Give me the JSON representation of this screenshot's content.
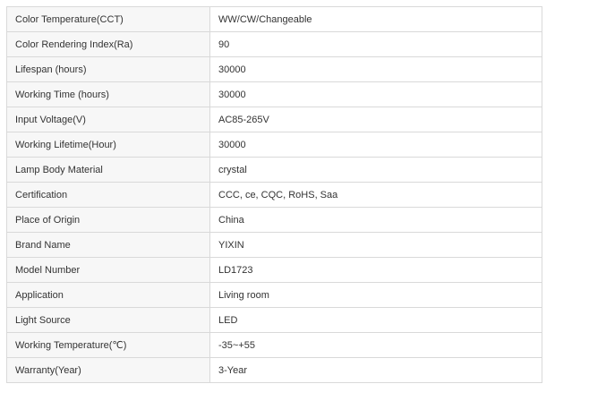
{
  "spec_table": {
    "rows": [
      {
        "label": "Color Temperature(CCT)",
        "value": "WW/CW/Changeable"
      },
      {
        "label": "Color Rendering Index(Ra)",
        "value": "90"
      },
      {
        "label": "Lifespan (hours)",
        "value": "30000"
      },
      {
        "label": "Working Time (hours)",
        "value": "30000"
      },
      {
        "label": "Input Voltage(V)",
        "value": "AC85-265V"
      },
      {
        "label": "Working Lifetime(Hour)",
        "value": "30000"
      },
      {
        "label": "Lamp Body Material",
        "value": "crystal"
      },
      {
        "label": "Certification",
        "value": "CCC, ce, CQC, RoHS, Saa"
      },
      {
        "label": "Place of Origin",
        "value": "China"
      },
      {
        "label": "Brand Name",
        "value": "YIXIN"
      },
      {
        "label": "Model Number",
        "value": "LD1723"
      },
      {
        "label": "Application",
        "value": "Living room"
      },
      {
        "label": "Light Source",
        "value": "LED"
      },
      {
        "label": "Working Temperature(℃)",
        "value": "-35~+55"
      },
      {
        "label": "Warranty(Year)",
        "value": "3-Year"
      }
    ]
  },
  "colors": {
    "label_background": "#f7f7f7",
    "border": "#d9d9d9",
    "text": "#333333"
  }
}
